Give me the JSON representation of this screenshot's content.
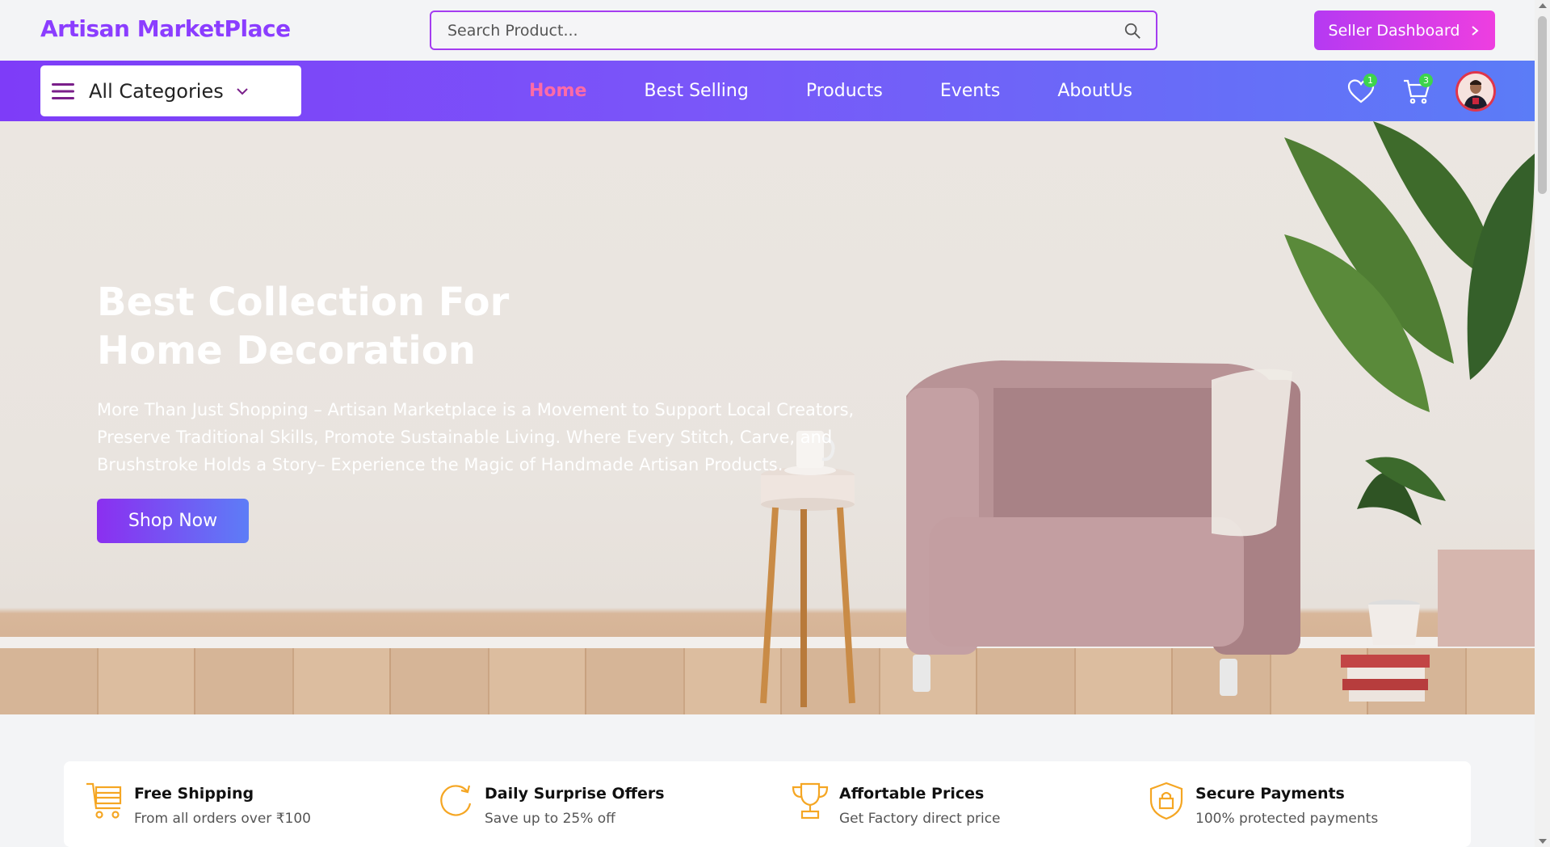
{
  "header": {
    "logo": "Artisan MarketPlace",
    "search_placeholder": "Search Product...",
    "seller_button": "Seller Dashboard"
  },
  "nav": {
    "categories_label": "All Categories",
    "links": [
      {
        "label": "Home",
        "active": true
      },
      {
        "label": "Best Selling",
        "active": false
      },
      {
        "label": "Products",
        "active": false
      },
      {
        "label": "Events",
        "active": false
      },
      {
        "label": "AboutUs",
        "active": false
      }
    ],
    "wishlist_count": "1",
    "cart_count": "3"
  },
  "hero": {
    "title": "Best Collection For Home Decoration",
    "description": "More Than Just Shopping – Artisan Marketplace is a Movement to Support Local Creators, Preserve Traditional Skills, Promote Sustainable Living. Where Every Stitch, Carve, and Brushstroke Holds a Story– Experience the Magic of Handmade Artisan Products.",
    "cta": "Shop Now"
  },
  "features": [
    {
      "icon": "cart-icon",
      "title": "Free Shipping",
      "subtitle": "From all orders over ₹100"
    },
    {
      "icon": "refresh-icon",
      "title": "Daily Surprise Offers",
      "subtitle": "Save up to 25% off"
    },
    {
      "icon": "trophy-icon",
      "title": "Affortable Prices",
      "subtitle": "Get Factory direct price"
    },
    {
      "icon": "shield-lock-icon",
      "title": "Secure Payments",
      "subtitle": "100% protected payments"
    }
  ],
  "colors": {
    "brand": "#8b3dff",
    "nav_gradient_start": "#7e3cf8",
    "nav_gradient_end": "#5b7cf7",
    "active_link": "#ff6ba6",
    "feature_icon": "#f5a623",
    "badge": "#3dd44c"
  }
}
